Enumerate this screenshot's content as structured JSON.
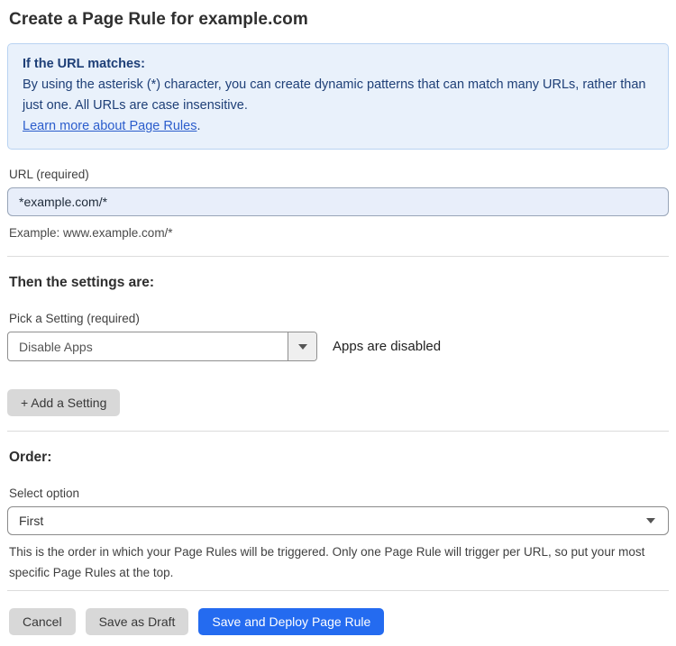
{
  "page": {
    "title": "Create a Page Rule for example.com"
  },
  "info_box": {
    "heading": "If the URL matches:",
    "body": "By using the asterisk (*) character, you can create dynamic patterns that can match many URLs, rather than just one. All URLs are case insensitive.",
    "link_label": "Learn more about Page Rules",
    "link_suffix": "."
  },
  "url_field": {
    "label": "URL (required)",
    "value": "*example.com/*",
    "helper": "Example: www.example.com/*"
  },
  "settings": {
    "heading": "Then the settings are:",
    "picker_label": "Pick a Setting (required)",
    "selected_setting": "Disable Apps",
    "status_text": "Apps are disabled",
    "add_button_label": "+ Add a Setting"
  },
  "order": {
    "heading": "Order:",
    "select_label": "Select option",
    "selected_option": "First",
    "helper": "This is the order in which your Page Rules will be triggered. Only one Page Rule will trigger per URL, so put your most specific Page Rules at the top."
  },
  "actions": {
    "cancel_label": "Cancel",
    "save_draft_label": "Save as Draft",
    "save_deploy_label": "Save and Deploy Page Rule"
  },
  "colors": {
    "accent_blue": "#246bf0",
    "info_box_bg": "#e9f1fb",
    "info_box_border": "#b9d3f2",
    "info_text": "#1e3f77",
    "link_blue": "#2b5dcc",
    "url_input_bg": "#e8eefa",
    "gray_button_bg": "#d8d8d8"
  },
  "icons": {
    "setting_dropdown_caret": "caret-down",
    "order_select_caret": "caret-down"
  }
}
